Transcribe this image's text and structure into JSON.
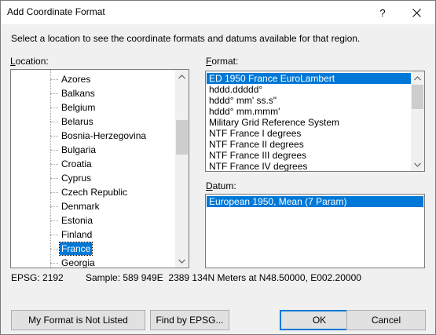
{
  "window": {
    "title": "Add Coordinate Format",
    "help_label": "?",
    "instruction": "Select a location to see the coordinate formats and datums available for that region."
  },
  "location": {
    "label_accel": "L",
    "label_rest": "ocation:",
    "items": [
      "Azores",
      "Balkans",
      "Belgium",
      "Belarus",
      "Bosnia-Herzegovina",
      "Bulgaria",
      "Croatia",
      "Cyprus",
      "Czech Republic",
      "Denmark",
      "Estonia",
      "Finland",
      "France",
      "Georgia"
    ],
    "selected": "France"
  },
  "format": {
    "label_accel": "F",
    "label_rest": "ormat:",
    "items": [
      "ED 1950 France EuroLambert",
      "hddd.ddddd°",
      "hddd° mm' ss.s\"",
      "hddd° mm.mmm'",
      "Military Grid Reference System",
      "NTF France I degrees",
      "NTF France II degrees",
      "NTF France III degrees",
      "NTF France IV degrees"
    ],
    "selected": "ED 1950 France EuroLambert"
  },
  "datum": {
    "label_accel": "D",
    "label_rest": "atum:",
    "items": [
      "European 1950, Mean (7 Param)"
    ],
    "selected": "European 1950, Mean (7 Param)"
  },
  "status": {
    "epsg": "EPSG: 2192",
    "sample": "Sample: 589 949E  2389 134N Meters at N48.50000, E002.20000"
  },
  "buttons": {
    "not_listed": "My Format is Not Listed",
    "find_epsg": "Find by EPSG...",
    "ok": "OK",
    "cancel": "Cancel"
  },
  "icons": {
    "scroll_up": "scroll-up-arrow",
    "scroll_down": "scroll-down-arrow",
    "close": "close-x"
  },
  "colors": {
    "selection": "#0078d7",
    "dialog_bg": "#f0f0f0"
  }
}
